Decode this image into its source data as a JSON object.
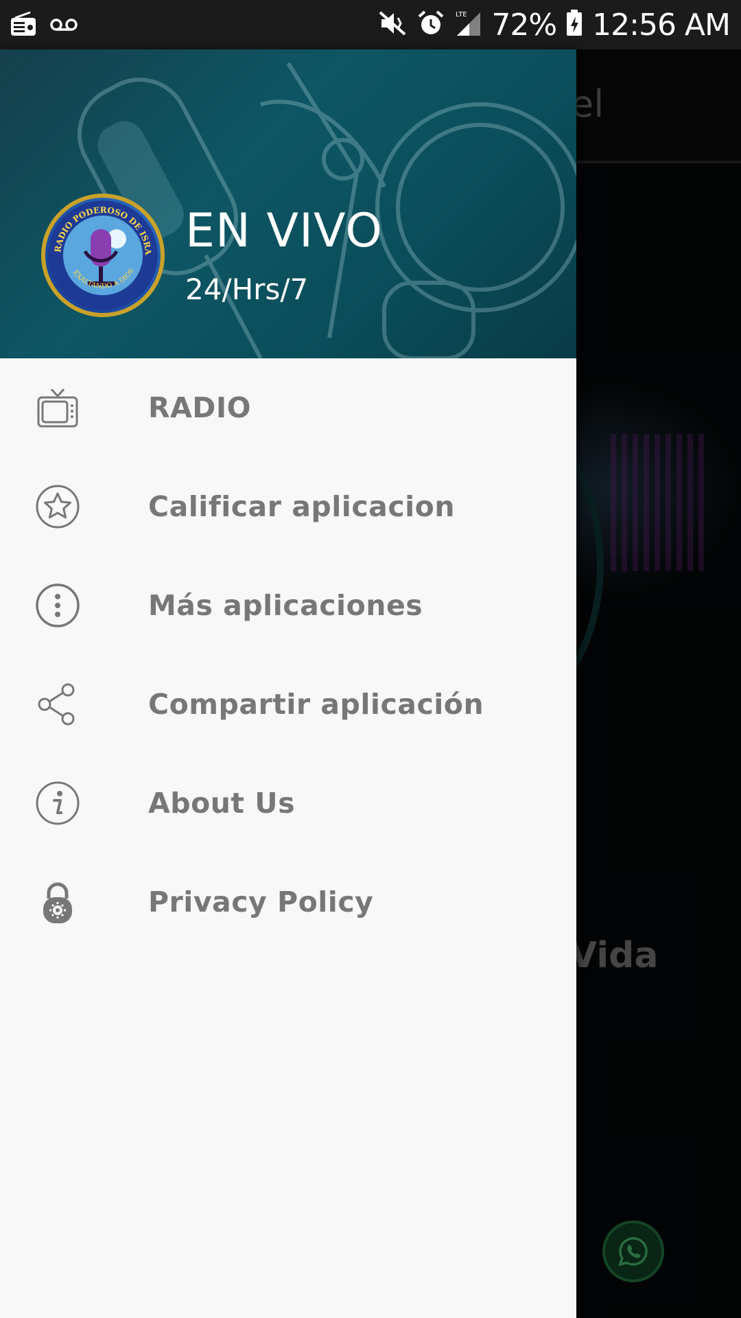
{
  "status_bar": {
    "battery_percent": "72%",
    "time": "12:56 AM",
    "network": "LTE",
    "icons": [
      "radio-notification-icon",
      "voicemail-icon",
      "mute-icon",
      "alarm-icon",
      "signal-icon",
      "battery-charging-icon"
    ]
  },
  "background_app": {
    "title_fragment": "el",
    "body_fragment": "Vida"
  },
  "drawer": {
    "header": {
      "title": "EN VIVO",
      "subtitle": "24/Hrs/7",
      "logo_text_top": "RADIO PODEROSO DE ISRAEL",
      "logo_text_bottom": "EXALTANDO A DIOS"
    },
    "items": [
      {
        "label": "RADIO",
        "icon": "tv-icon"
      },
      {
        "label": "Calificar aplicacion",
        "icon": "star-circle-icon"
      },
      {
        "label": "Más aplicaciones",
        "icon": "more-vert-circle-icon"
      },
      {
        "label": "Compartir aplicación",
        "icon": "share-icon"
      },
      {
        "label": "About Us",
        "icon": "info-icon"
      },
      {
        "label": "Privacy Policy",
        "icon": "lock-gear-icon"
      }
    ]
  },
  "colors": {
    "drawer_bg": "#f8f8f8",
    "header_teal": "#0e5664",
    "menu_text": "#777777",
    "status_bar": "#1b1b1b"
  }
}
